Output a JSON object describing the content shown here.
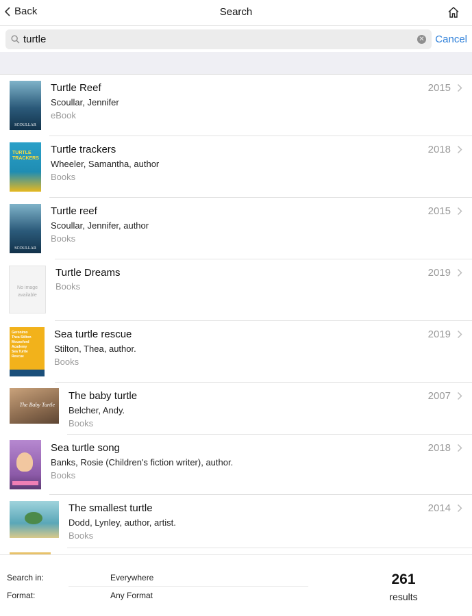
{
  "nav": {
    "back_label": "Back",
    "title": "Search"
  },
  "search": {
    "query": "turtle",
    "cancel_label": "Cancel"
  },
  "results": [
    {
      "title": "Turtle Reef",
      "author": "Scoullar, Jennifer",
      "format": "eBook",
      "year": "2015",
      "cover_color": "#2b5a7a"
    },
    {
      "title": "Turtle trackers",
      "author": "Wheeler, Samantha, author",
      "format": "Books",
      "year": "2018",
      "cover_color": "#1f8db3"
    },
    {
      "title": "Turtle reef",
      "author": "Scoullar, Jennifer, author",
      "format": "Books",
      "year": "2015",
      "cover_color": "#2b5a7a"
    },
    {
      "title": "Turtle Dreams",
      "author": "",
      "format": "Books",
      "year": "2019",
      "cover_text": "No image available"
    },
    {
      "title": "Sea turtle rescue",
      "author": "Stilton, Thea, author.",
      "format": "Books",
      "year": "2019",
      "cover_color": "#f2b21b"
    },
    {
      "title": "The baby turtle",
      "author": "Belcher, Andy.",
      "format": "Books",
      "year": "2007",
      "cover_color": "#8a6a4e"
    },
    {
      "title": "Sea turtle song",
      "author": "Banks, Rosie (Children's fiction writer), author.",
      "format": "Books",
      "year": "2018",
      "cover_color": "#8c5aa8"
    },
    {
      "title": "The smallest turtle",
      "author": "Dodd, Lynley, author, artist.",
      "format": "Books",
      "year": "2014",
      "cover_color": "#5aa7b8"
    }
  ],
  "footer": {
    "search_in_label": "Search in:",
    "search_in_value": "Everywhere",
    "format_label": "Format:",
    "format_value": "Any Format",
    "count": "261",
    "count_label": "results"
  }
}
